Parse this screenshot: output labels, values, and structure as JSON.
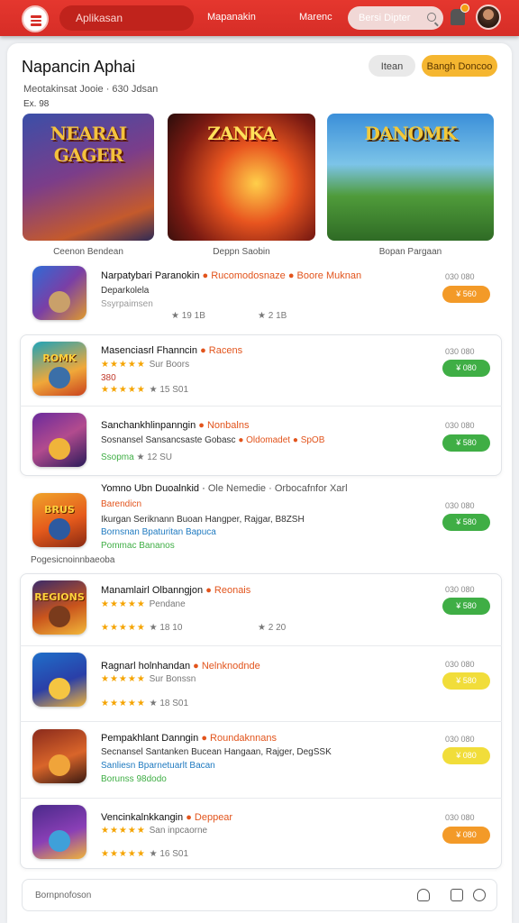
{
  "header": {
    "menu_icon": "hamburger-menu-icon",
    "app_label": "Aplikasan",
    "nav": [
      "Mapanakin",
      "Marenc"
    ],
    "search_placeholder": "Bersi Dipter"
  },
  "page": {
    "title": "Napancin Aphai",
    "filter_label": "Itean",
    "primary_label": "Bangh Doncoo",
    "meta_line": "Meotakinsat Jooie  ·  630 Jdsan",
    "meta_line2": "Ex. 98"
  },
  "banners": [
    {
      "title": "NEARAI GAGER",
      "caption": "Ceenon Bendean"
    },
    {
      "title": "ZANKA",
      "caption": "Deppn Saobin"
    },
    {
      "title": "DANOMK",
      "caption": "Bopan Pargaan"
    }
  ],
  "apps": [
    {
      "name": "Narpatybari Paranokin",
      "tag": "Rucomodosnaze",
      "tag2": "Boore Muknan",
      "line2": "Deparkolela",
      "line3": "Ssyrpaimsen",
      "rating": "19 1B",
      "rating2": "2 1B",
      "price": "030 080",
      "action": "¥ 560"
    },
    {
      "name": "Masenciasrl Fhanncin",
      "tag": "Racens",
      "line2": "Sur Boors",
      "line3": "380",
      "rating": "15 S01",
      "price": "030 080",
      "action": "¥ 080"
    },
    {
      "name": "Sanchankhlinpanngin",
      "tag": "Nonbalns",
      "line2": "Sosnansel Sansancsaste Gobasc",
      "line3": "Ssopma",
      "tag3": "Oldomadet",
      "tag4": "SpOB",
      "rating": "12 SU",
      "price": "030 080",
      "action": "¥ 580"
    },
    {
      "name": "Yomno Ubn Duoalnkid",
      "tag": "Barendicn",
      "line2": "Ikurgan Seriknann Buoan Hangper, Rajgar, B8ZSH",
      "line3": "Bornsnan Bpaturitan Bapuca",
      "line4": "Pommac Bananos",
      "meta": "Ole Nemedie  ·  Orbocafnfor Xarl",
      "price": "030 080",
      "action": "¥ 580"
    },
    {
      "name": "Manamlairl Olbanngjon",
      "tag": "Reonais",
      "line2": "Pendane",
      "rating": "18 10",
      "rating2": "2 20",
      "price": "030 080",
      "action": "¥ 580"
    },
    {
      "name": "Ragnarl holnhandan",
      "tag": "Nelnknodnde",
      "line2": "Sur Bonssn",
      "rating": "18 S01",
      "price": "030 080",
      "action": "¥ 580"
    },
    {
      "name": "Pempakhlant Danngin",
      "tag": "Roundaknnans",
      "line2": "Secnansel Santanken Bucean Hangaan, Rajger, DegSSK",
      "line3": "Sanliesn Bparnetuarlt Bacan",
      "line4": "Borunss 98dodo",
      "price": "030 080",
      "action": "¥ 080"
    },
    {
      "name": "Vencinkalnkkangin",
      "tag": "Deppear",
      "line2": "San inpcaorne",
      "rating": "16 S01",
      "price": "030 080",
      "action": "¥ 080"
    }
  ],
  "section_label": "Pogesicnoinnbaeoba",
  "footer": {
    "label": "Bornpnofoson"
  },
  "colors": {
    "brand_red": "#d62d27",
    "accent_orange": "#f39a28",
    "accent_green": "#3fae45",
    "accent_yellow": "#f1dd3a"
  }
}
